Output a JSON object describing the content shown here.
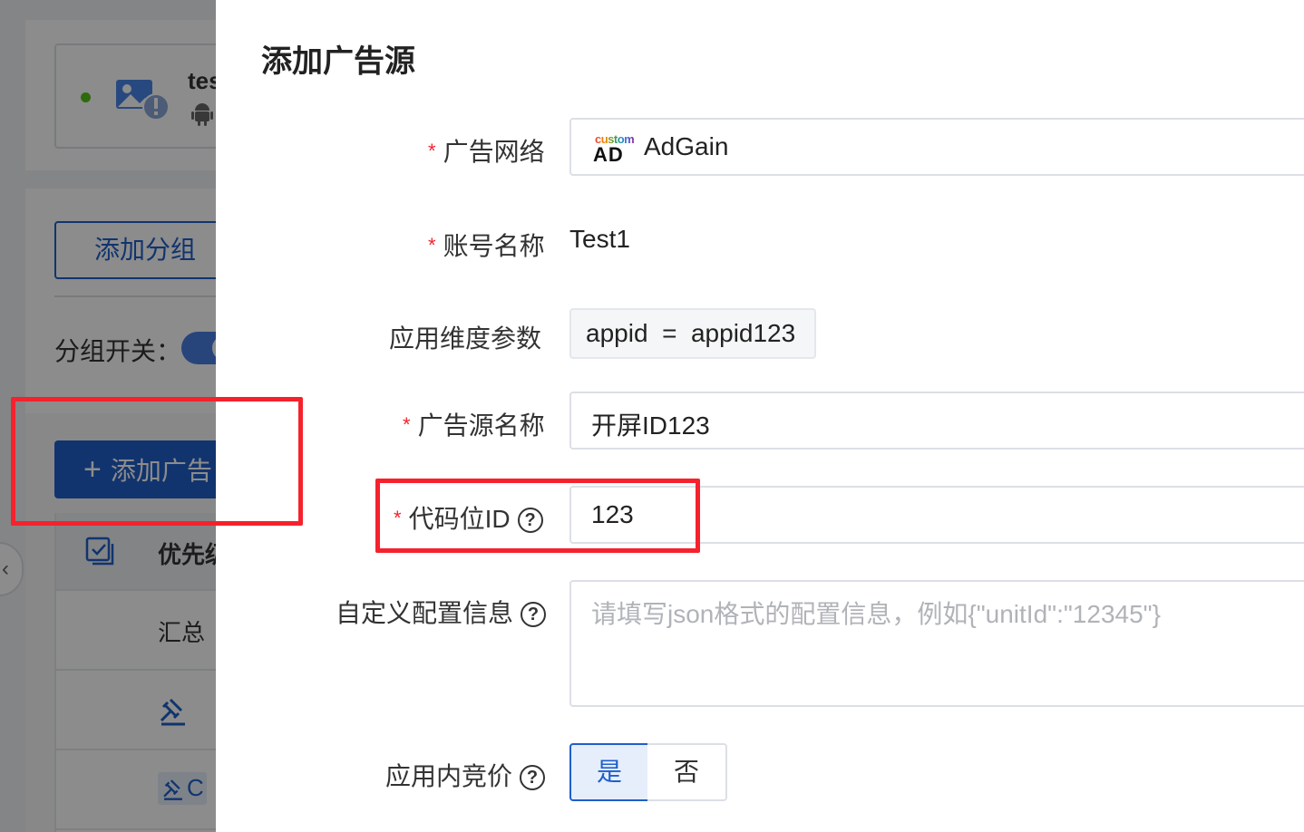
{
  "background": {
    "app_card": {
      "name": "tes",
      "status_color": "#52c41a"
    },
    "add_group_button": "添加分组",
    "group_switch_label": "分组开关：",
    "add_ad_button": "添加广告",
    "add_ad_plus": "+",
    "table": {
      "header_priority": "优先级",
      "summary_row": "汇总",
      "badge_text": "C"
    },
    "collapse_glyph": "‹"
  },
  "drawer": {
    "title": "添加广告源",
    "fields": {
      "ad_network": {
        "required": "*",
        "label": "广告网络",
        "logo_small": "custom",
        "logo_big": "AD",
        "value": "AdGain"
      },
      "account_name": {
        "required": "*",
        "label": "账号名称",
        "value": "Test1"
      },
      "app_params": {
        "label": "应用维度参数",
        "value": "appid  =  appid123"
      },
      "source_name": {
        "required": "*",
        "label": "广告源名称",
        "value": "开屏ID123"
      },
      "code_id": {
        "required": "*",
        "label": "代码位ID",
        "help": "?",
        "value": "123"
      },
      "custom_config": {
        "label": "自定义配置信息",
        "help": "?",
        "placeholder": "请填写json格式的配置信息，例如{\"unitId\":\"12345\"}"
      },
      "in_app_bidding": {
        "label": "应用内竞价",
        "help": "?",
        "options": [
          "是",
          "否"
        ],
        "selected": "是"
      }
    }
  },
  "colors": {
    "primary": "#1f5fc9",
    "required": "#f5222d",
    "highlight_box": "#f5222d"
  }
}
